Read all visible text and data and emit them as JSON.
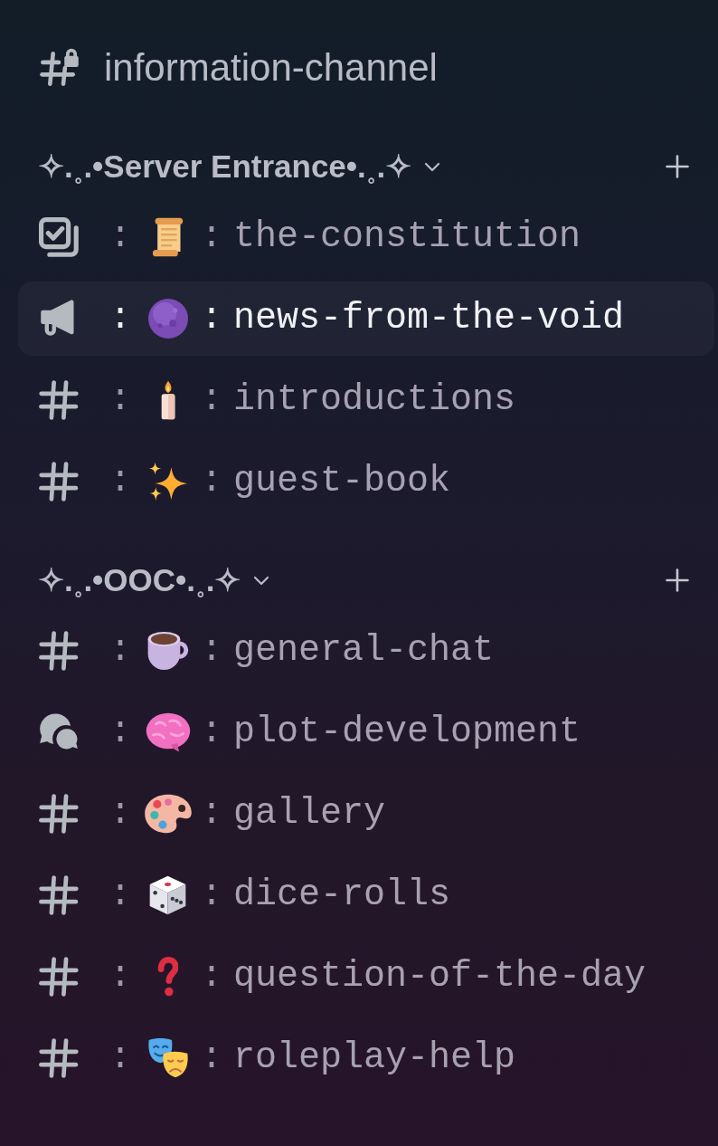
{
  "top_channel": {
    "kind": "locked",
    "name": "information-channel",
    "selected": false
  },
  "categories": [
    {
      "title": "✧.˳.•Server Entrance•.˳.✧",
      "expanded": true,
      "channels": [
        {
          "kind": "rules",
          "left_separator": ":",
          "emoji": {
            "kind": "scroll"
          },
          "right_separator": ":",
          "name": "the-constitution",
          "selected": false
        },
        {
          "kind": "announcement",
          "left_separator": ":",
          "emoji": {
            "kind": "orb"
          },
          "right_separator": ":",
          "name": "news-from-the-void",
          "selected": true
        },
        {
          "kind": "text",
          "left_separator": ":",
          "emoji": {
            "kind": "candle"
          },
          "right_separator": ":",
          "name": "introductions",
          "selected": false
        },
        {
          "kind": "text",
          "left_separator": ":",
          "emoji": {
            "kind": "sparkles"
          },
          "right_separator": ":",
          "name": "guest-book",
          "selected": false
        }
      ]
    },
    {
      "title": "✧.˳.•OOC•.˳.✧",
      "expanded": true,
      "channels": [
        {
          "kind": "text",
          "left_separator": ":",
          "emoji": {
            "kind": "coffee"
          },
          "right_separator": ":",
          "name": "general-chat",
          "selected": false
        },
        {
          "kind": "forum",
          "left_separator": ":",
          "emoji": {
            "kind": "brain"
          },
          "right_separator": ":",
          "name": "plot-development",
          "selected": false
        },
        {
          "kind": "text",
          "left_separator": ":",
          "emoji": {
            "kind": "palette"
          },
          "right_separator": ":",
          "name": "gallery",
          "selected": false
        },
        {
          "kind": "text",
          "left_separator": ":",
          "emoji": {
            "kind": "die"
          },
          "right_separator": ":",
          "name": "dice-rolls",
          "selected": false
        },
        {
          "kind": "text",
          "left_separator": ":",
          "emoji": {
            "kind": "question"
          },
          "right_separator": ":",
          "name": "question-of-the-day",
          "selected": false
        },
        {
          "kind": "text",
          "left_separator": ":",
          "emoji": {
            "kind": "masks"
          },
          "right_separator": ":",
          "name": "roleplay-help",
          "selected": false
        }
      ]
    }
  ]
}
